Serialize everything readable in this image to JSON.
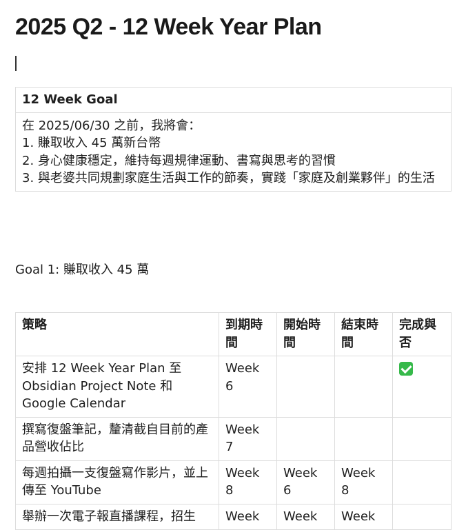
{
  "title": "2025 Q2 - 12 Week Year Plan",
  "goal_table": {
    "header": "12 Week Goal",
    "lines": [
      "在 2025/06/30 之前，我將會：",
      "1. 賺取收入 45 萬新台幣",
      "2. 身心健康穩定，維持每週規律運動、書寫與思考的習慣",
      "3. 與老婆共同規劃家庭生活與工作的節奏，實踐「家庭及創業夥伴」的生活"
    ]
  },
  "goal1_heading": "Goal 1: 賺取收入 45 萬",
  "plan_table": {
    "headers": [
      "策略",
      "到期時間",
      "開始時間",
      "結束時間",
      "完成與否"
    ],
    "rows": [
      {
        "strategy": "安排 12 Week Year Plan 至 Obsidian Project Note 和 Google Calendar",
        "due": "Week 6",
        "start": "",
        "end": "",
        "done": true,
        "done_icon": "check-mark-button-icon"
      },
      {
        "strategy": "撰寫復盤筆記，釐清截自目前的產品營收佔比",
        "due": "Week 7",
        "start": "",
        "end": "",
        "done": false
      },
      {
        "strategy": "每週拍攝一支復盤寫作影片，並上傳至 YouTube",
        "due": "Week 8",
        "start": "Week 6",
        "end": "Week 8",
        "done": false
      },
      {
        "strategy": "舉辦一次電子報直播課程，招生",
        "due": "Week",
        "start": "Week",
        "end": "Week",
        "done": false
      }
    ]
  },
  "colors": {
    "border": "#dcdcdc",
    "text": "#1f1f1f",
    "check": "#36b94a"
  }
}
